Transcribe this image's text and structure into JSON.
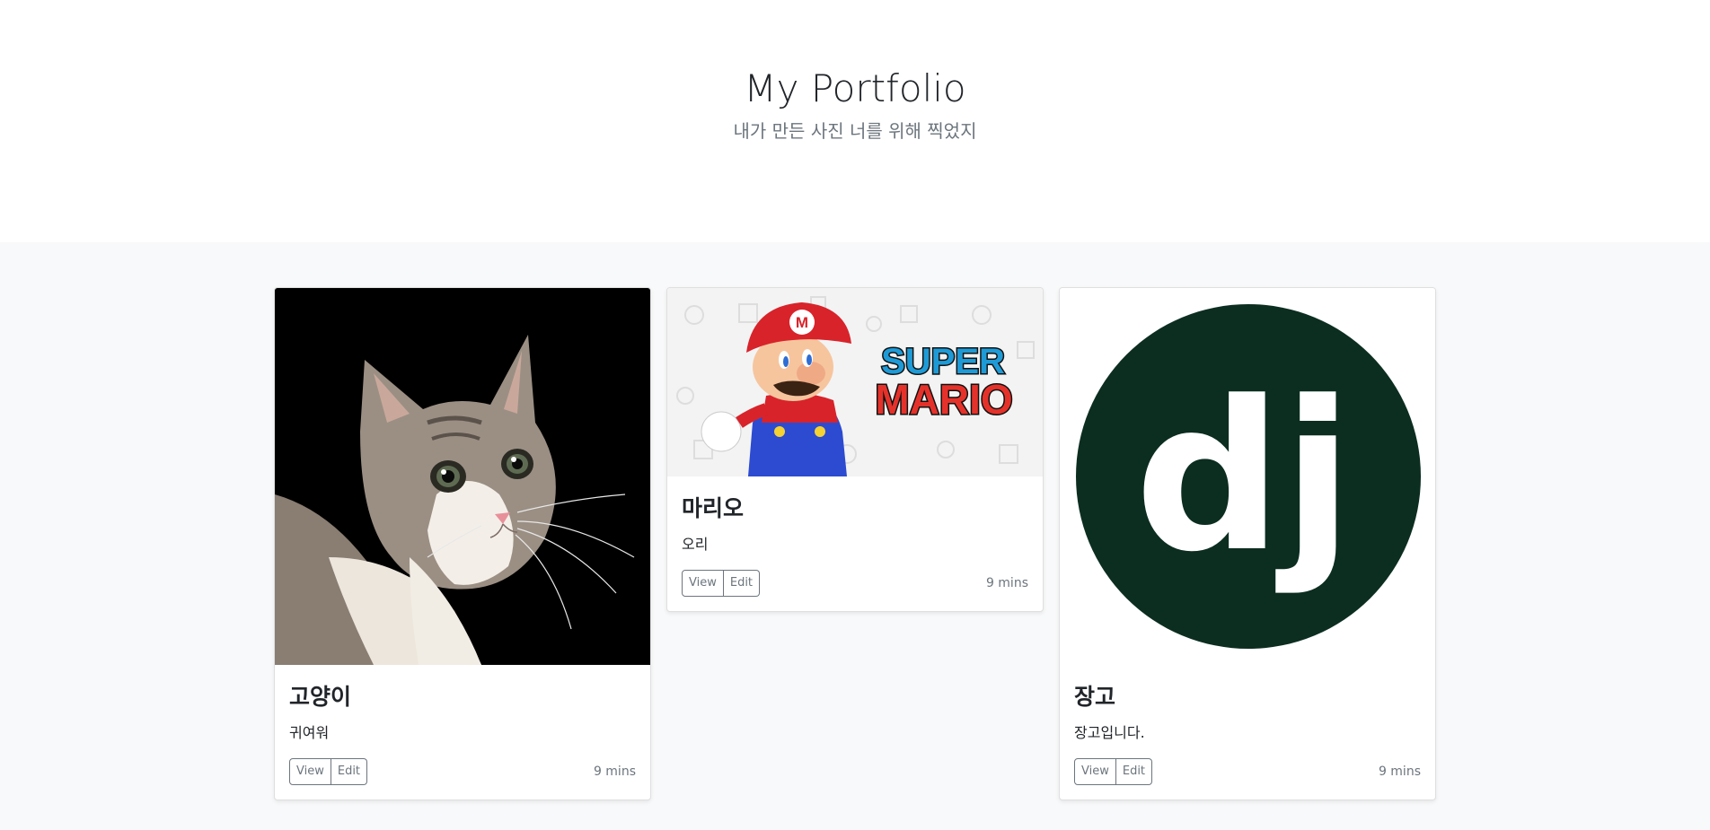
{
  "header": {
    "title": "My Portfolio",
    "subtitle": "내가 만든 사진 너를 위해 찍었지"
  },
  "cards": [
    {
      "title": "고양이",
      "text": "귀여워",
      "view_label": "View",
      "edit_label": "Edit",
      "time": "9 mins",
      "image": "cat-photo"
    },
    {
      "title": "마리오",
      "text": "오리",
      "view_label": "View",
      "edit_label": "Edit",
      "time": "9 mins",
      "image": "super-mario-banner",
      "logo_text": [
        "SUPER",
        "MARIO"
      ]
    },
    {
      "title": "장고",
      "text": "장고입니다.",
      "view_label": "View",
      "edit_label": "Edit",
      "time": "9 mins",
      "image": "django-logo",
      "logo_text": "dj"
    }
  ],
  "colors": {
    "album_bg": "#f8f9fa",
    "django_green": "#0c2e21",
    "muted": "#6c757d"
  }
}
